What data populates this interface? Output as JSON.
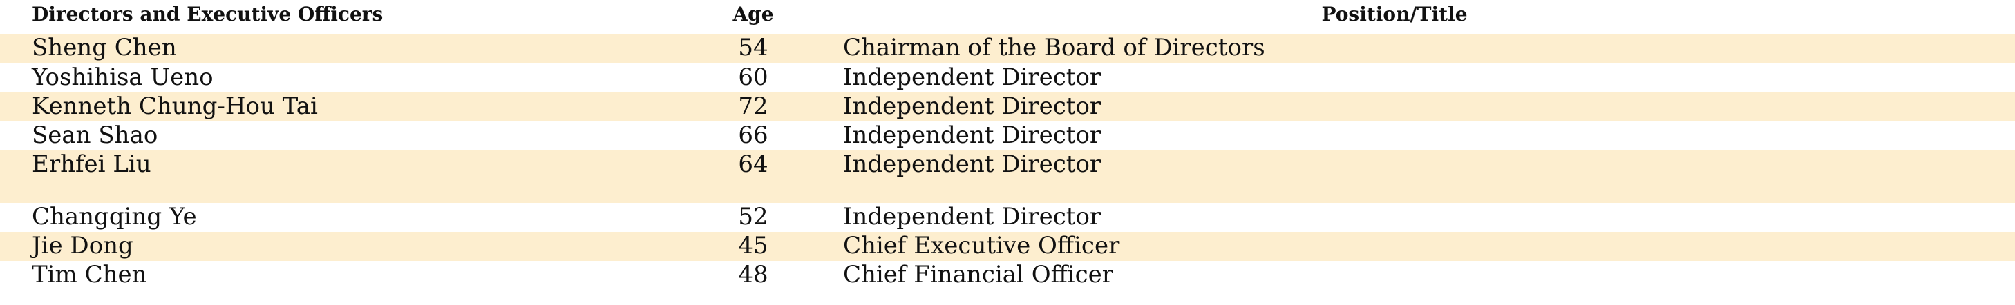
{
  "table": {
    "headers": {
      "name": "Directors and Executive Officers",
      "age": "Age",
      "position": "Position/Title"
    },
    "rows": [
      {
        "name": "Sheng Chen",
        "age": "54",
        "position": "Chairman of the Board of Directors"
      },
      {
        "name": "Yoshihisa Ueno",
        "age": "60",
        "position": "Independent Director"
      },
      {
        "name": "Kenneth Chung-Hou Tai",
        "age": "72",
        "position": "Independent Director"
      },
      {
        "name": "Sean Shao",
        "age": "66",
        "position": "Independent Director"
      },
      {
        "name": "Erhfei Liu",
        "age": "64",
        "position": "Independent Director"
      },
      {
        "name": "Changqing Ye",
        "age": "52",
        "position": "Independent Director"
      },
      {
        "name": "Jie Dong",
        "age": "45",
        "position": "Chief Executive Officer"
      },
      {
        "name": "Tim Chen",
        "age": "48",
        "position": "Chief Financial Officer"
      }
    ],
    "shade_color": "#fdeecf"
  }
}
